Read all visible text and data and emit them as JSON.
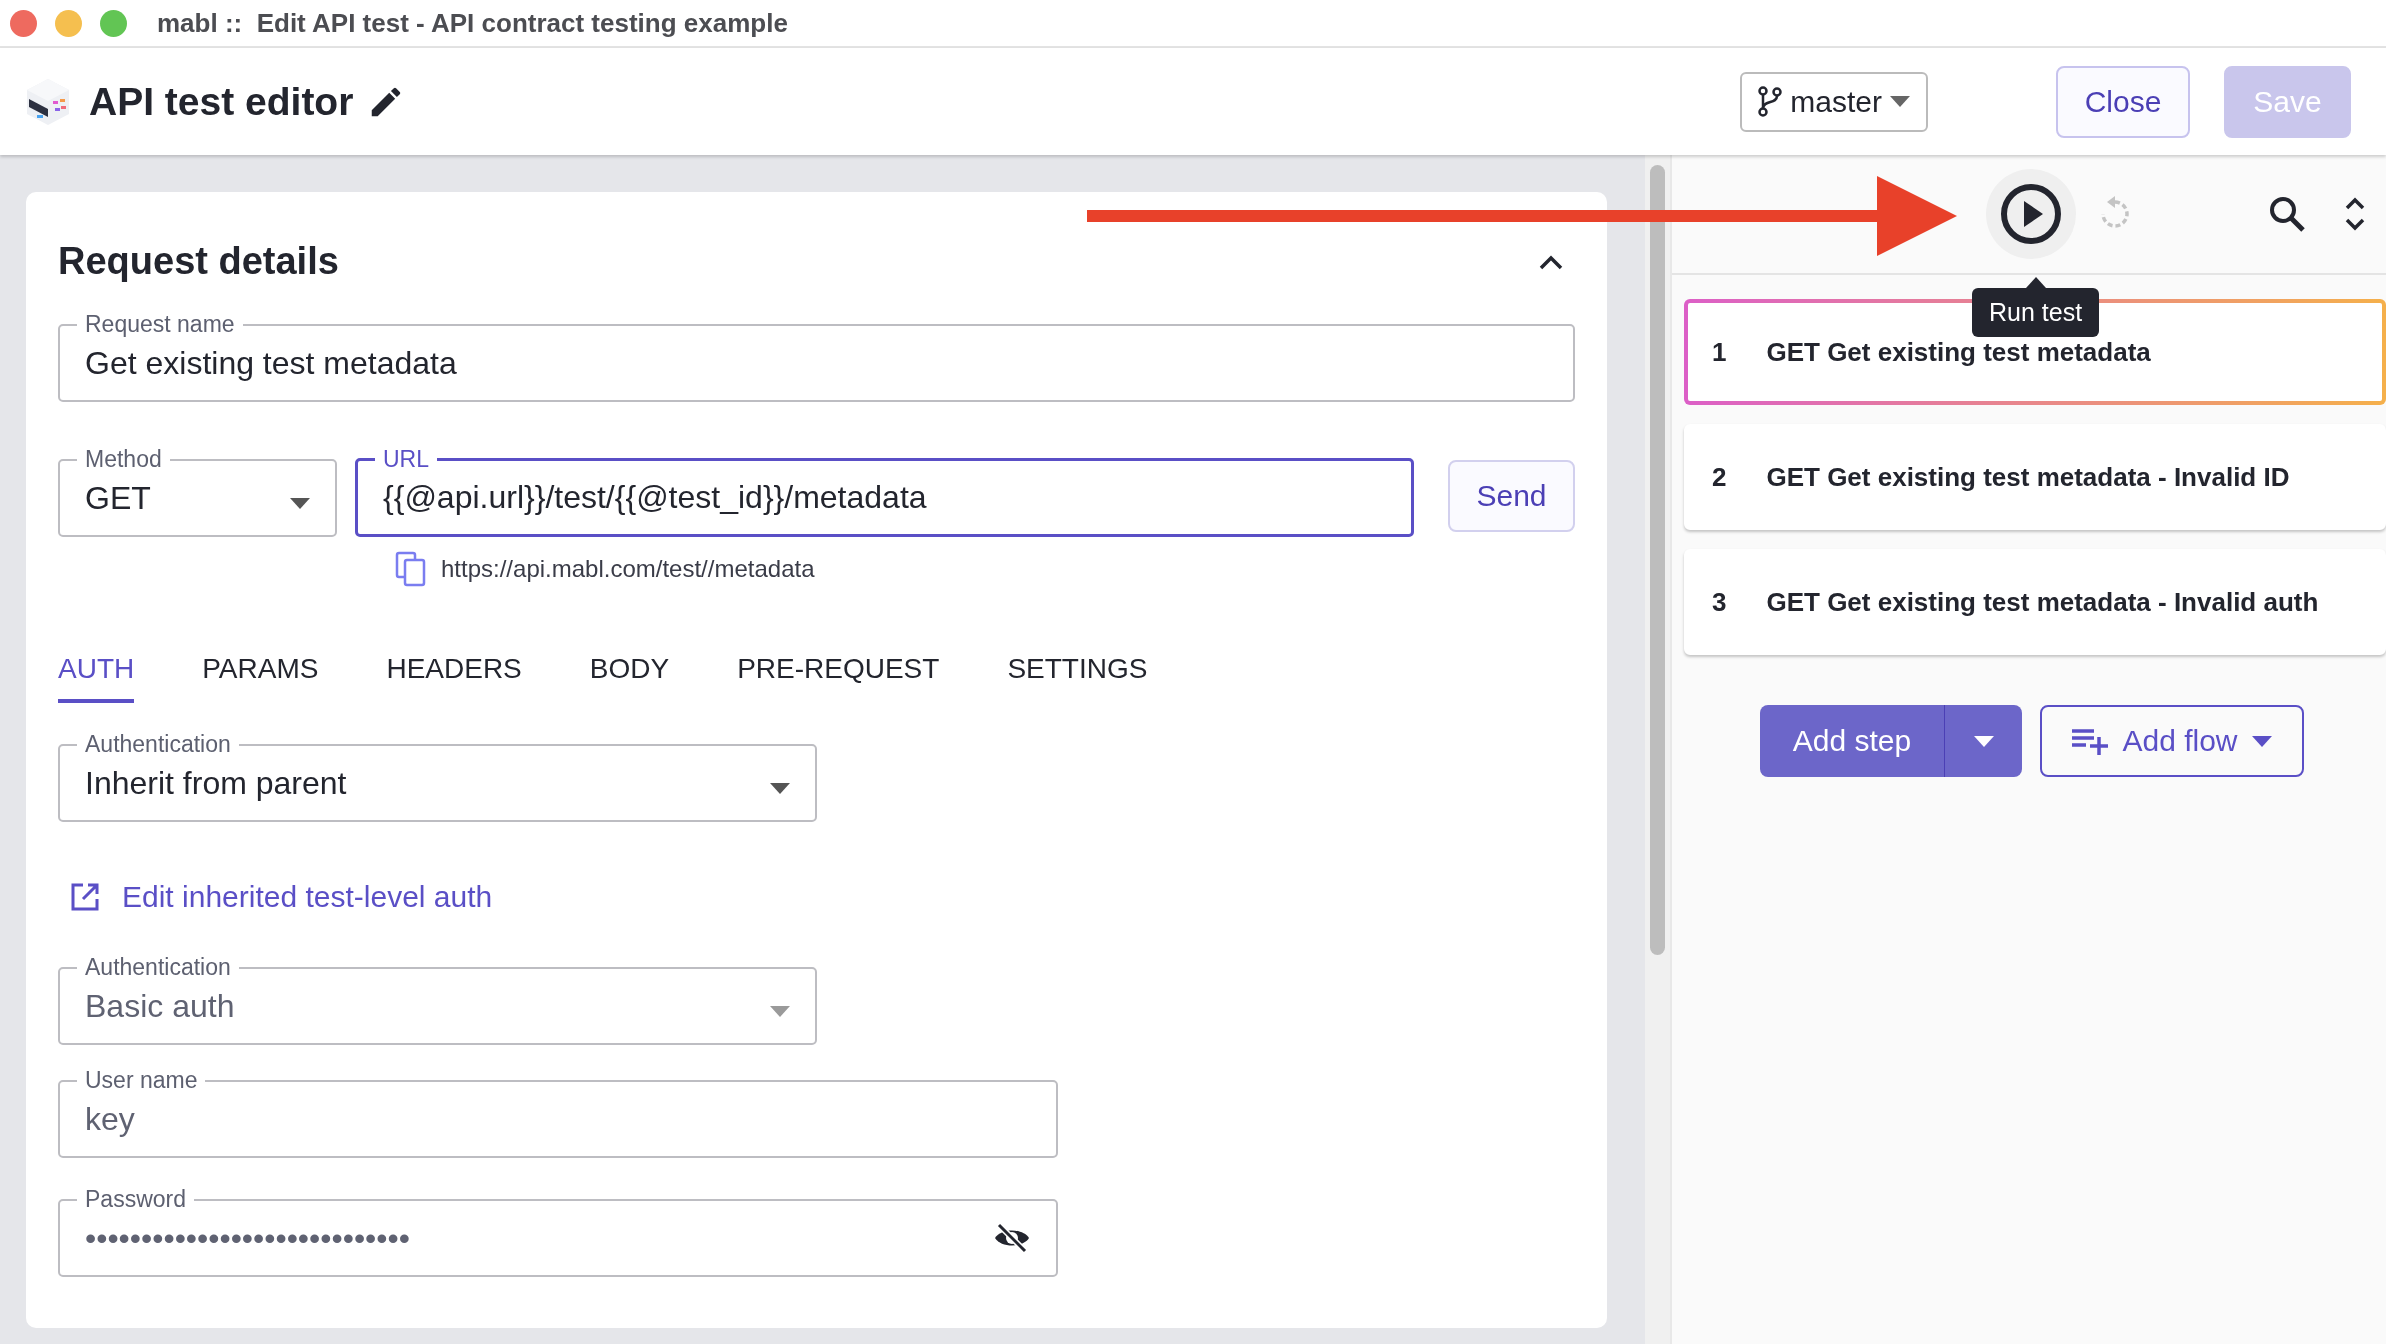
{
  "window": {
    "title": "mabl ::  Edit API test - API contract testing example"
  },
  "header": {
    "title": "API test editor",
    "branch": "master",
    "buttons": [
      {
        "label": "Close",
        "disabled": false
      },
      {
        "label": "Save",
        "disabled": true
      }
    ]
  },
  "request": {
    "heading": "Request details",
    "expanded": true,
    "name_field": {
      "label": "Request name",
      "value": "Get existing test metadata"
    },
    "method": {
      "label": "Method",
      "value": "GET"
    },
    "url": {
      "label": "URL",
      "value": "{{@api.url}}/test/{{@test_id}}/metadata",
      "focused": true
    },
    "send": "Send",
    "resolved_url": "https://api.mabl.com/test//metadata",
    "tabs": [
      {
        "label": "AUTH",
        "selected": true
      },
      {
        "label": "PARAMS",
        "selected": false
      },
      {
        "label": "HEADERS",
        "selected": false
      },
      {
        "label": "BODY",
        "selected": false
      },
      {
        "label": "PRE-REQUEST",
        "selected": false
      },
      {
        "label": "SETTINGS",
        "selected": false
      }
    ],
    "auth": {
      "select": {
        "label": "Authentication",
        "value": "Inherit from parent",
        "disabled": false
      },
      "edit_link": "Edit inherited test-level auth",
      "inherited": {
        "label": "Authentication",
        "value": "Basic auth",
        "disabled": true
      },
      "username": {
        "label": "User name",
        "value": "key",
        "disabled": true
      },
      "password": {
        "label": "Password",
        "value": "•••••••••••••••••••••••••••••",
        "disabled": true
      }
    }
  },
  "steps_panel": {
    "tooltip": "Run test",
    "steps": [
      {
        "number": "1",
        "label": "GET Get existing test metadata",
        "selected": true
      },
      {
        "number": "2",
        "label": "GET Get existing test metadata - Invalid ID",
        "selected": false
      },
      {
        "number": "3",
        "label": "GET Get existing test metadata - Invalid auth",
        "selected": false
      }
    ],
    "add_step": "Add step",
    "add_flow": "Add flow"
  }
}
